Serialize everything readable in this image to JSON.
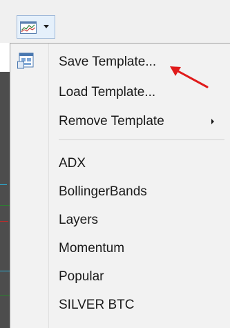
{
  "toolbar": {
    "template_button_icon": "chart-template-icon",
    "dropdown_icon": "chevron-down-icon"
  },
  "menu": {
    "items": [
      {
        "label": "Save Template...",
        "icon": "save-template-icon"
      },
      {
        "label": "Load Template..."
      },
      {
        "label": "Remove Template",
        "has_submenu": true,
        "submenu_icon": "chevron-right-icon"
      }
    ],
    "templates": [
      {
        "label": "ADX"
      },
      {
        "label": "BollingerBands"
      },
      {
        "label": "Layers"
      },
      {
        "label": "Momentum"
      },
      {
        "label": "Popular"
      },
      {
        "label": "SILVER BTC"
      }
    ]
  },
  "annotation": {
    "icon": "red-arrow-icon",
    "color": "#e01b1b"
  }
}
